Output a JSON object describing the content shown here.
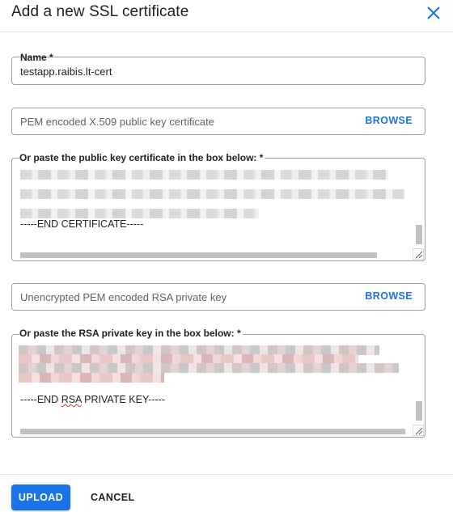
{
  "dialog": {
    "title": "Add a new SSL certificate",
    "close_icon": "close-icon"
  },
  "name_field": {
    "label": "Name *",
    "value": "testapp.raibis.lt-cert"
  },
  "public_cert_file": {
    "placeholder": "PEM encoded X.509 public key certificate",
    "browse_label": "BROWSE"
  },
  "public_cert_text": {
    "label": "Or paste the public key certificate in the box below: *",
    "end_line": "-----END CERTIFICATE-----"
  },
  "private_key_file": {
    "placeholder": "Unencrypted PEM encoded RSA private key",
    "browse_label": "BROWSE"
  },
  "private_key_text": {
    "label": "Or paste the RSA private key in the box below: *",
    "end_line_prefix": "-----END ",
    "end_line_rsa": "RSA",
    "end_line_suffix": " PRIVATE KEY-----"
  },
  "footer": {
    "upload_label": "UPLOAD",
    "cancel_label": "CANCEL"
  },
  "colors": {
    "accent": "#1a73e8",
    "border": "#9aa0a6"
  }
}
